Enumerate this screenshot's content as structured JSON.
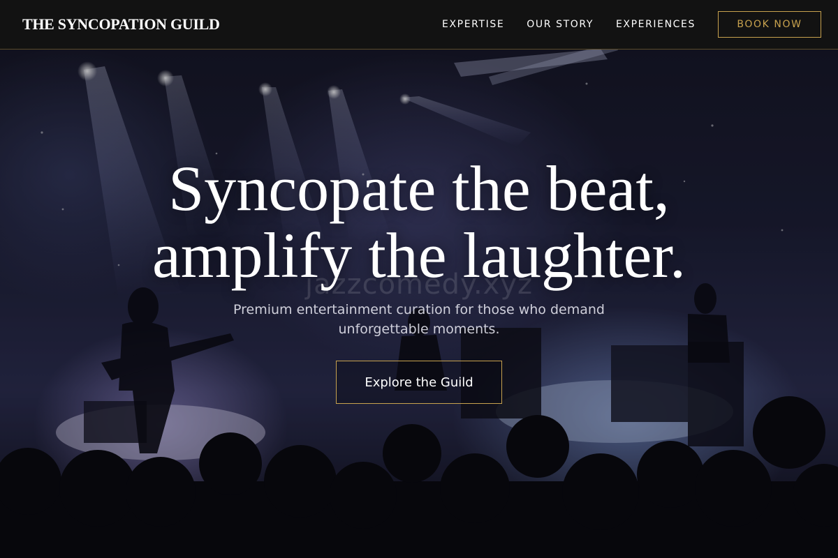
{
  "header": {
    "brand": "THE SYNCOPATION GUILD",
    "nav": [
      {
        "label": "EXPERTISE"
      },
      {
        "label": "OUR STORY"
      },
      {
        "label": "EXPERIENCES"
      }
    ],
    "book_label": "BOOK NOW"
  },
  "hero": {
    "headline_line1": "Syncopate the beat,",
    "headline_line2": "amplify the laughter.",
    "subheading": "Premium entertainment curation for those who demand unforgettable moments.",
    "cta_label": "Explore the Guild",
    "watermark": "jazzcomedy.xyz",
    "background_image": "concert-stage-crowd"
  },
  "colors": {
    "accent_gold": "#c8a24e",
    "header_bg": "#121212",
    "text_primary": "#ffffff"
  }
}
